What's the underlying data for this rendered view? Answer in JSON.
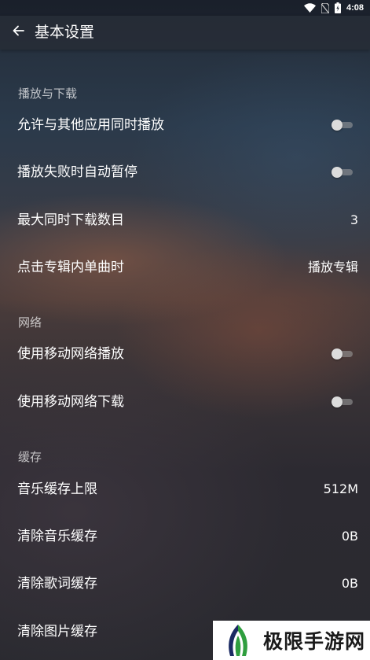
{
  "status_bar": {
    "time": "4:08",
    "icons": [
      "wifi-icon",
      "no-sim-icon",
      "battery-icon"
    ]
  },
  "app_bar": {
    "back_icon": "arrow-left-icon",
    "title": "基本设置"
  },
  "sections": [
    {
      "header": "播放与下载",
      "items": [
        {
          "label": "允许与其他应用同时播放",
          "type": "toggle",
          "on": false
        },
        {
          "label": "播放失败时自动暂停",
          "type": "toggle",
          "on": false
        },
        {
          "label": "最大同时下载数目",
          "type": "value",
          "value": "3"
        },
        {
          "label": "点击专辑内单曲时",
          "type": "value",
          "value": "播放专辑"
        }
      ]
    },
    {
      "header": "网络",
      "items": [
        {
          "label": "使用移动网络播放",
          "type": "toggle",
          "on": false
        },
        {
          "label": "使用移动网络下载",
          "type": "toggle",
          "on": false
        }
      ]
    },
    {
      "header": "缓存",
      "items": [
        {
          "label": "音乐缓存上限",
          "type": "value",
          "value": "512M"
        },
        {
          "label": "清除音乐缓存",
          "type": "value",
          "value": "0B"
        },
        {
          "label": "清除歌词缓存",
          "type": "value",
          "value": "0B"
        },
        {
          "label": "清除图片缓存",
          "type": "value",
          "value": ""
        }
      ]
    }
  ],
  "watermark": {
    "text": "极限手游网",
    "logo_icon": "leaf-logo-icon"
  },
  "colors": {
    "app_bar": "#262c36",
    "text": "#ffffff",
    "section_header": "#b3b3b3",
    "toggle_off_track": "#8a8a8a",
    "toggle_off_thumb": "#dcdcdc",
    "logo_green": "#2f9e3e",
    "logo_navy": "#1b2a63"
  }
}
